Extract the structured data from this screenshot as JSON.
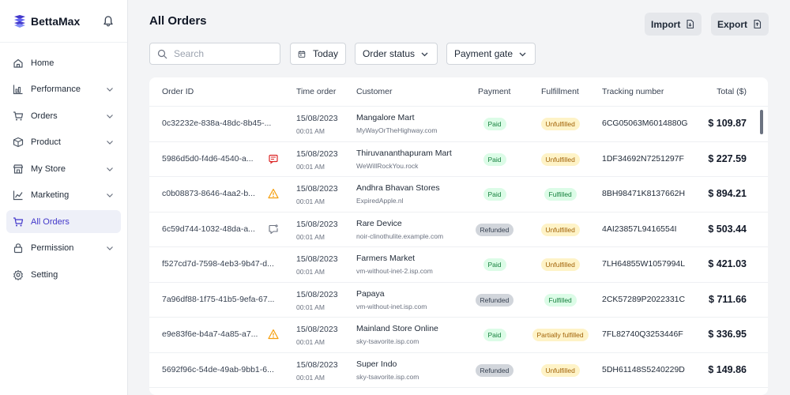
{
  "brand": {
    "name": "BettaMax",
    "logo_icon": "betta-logo-icon",
    "accent": "#4338ca"
  },
  "sidebar": {
    "items": [
      {
        "label": "Home",
        "icon": "home-icon",
        "chevron": false
      },
      {
        "label": "Performance",
        "icon": "chart-icon",
        "chevron": true
      },
      {
        "label": "Orders",
        "icon": "cart-icon",
        "chevron": true
      },
      {
        "label": "Product",
        "icon": "box-icon",
        "chevron": true
      },
      {
        "label": "My Store",
        "icon": "store-icon",
        "chevron": true
      },
      {
        "label": "Marketing",
        "icon": "marketing-chart-icon",
        "chevron": true
      },
      {
        "label": "All Orders",
        "icon": "cart-icon",
        "chevron": false,
        "active": true
      },
      {
        "label": "Permission",
        "icon": "lock-icon",
        "chevron": true
      },
      {
        "label": "Setting",
        "icon": "gear-icon",
        "chevron": false
      }
    ]
  },
  "header": {
    "title": "All Orders",
    "import_label": "Import",
    "export_label": "Export"
  },
  "filters": {
    "search_placeholder": "Search",
    "date_label": "Today",
    "status_label": "Order status",
    "gateway_label": "Payment gate"
  },
  "table": {
    "columns": [
      "Order ID",
      "Time order",
      "Customer",
      "Payment",
      "Fulfillment",
      "Tracking number",
      "Total ($)"
    ],
    "rows": [
      {
        "order_id": "0c32232e-838a-48dc-8b45-...",
        "icon": "",
        "date": "15/08/2023",
        "time": "00:01 AM",
        "customer": "Mangalore Mart",
        "domain": "MyWayOrTheHighway.com",
        "payment": "Paid",
        "fulfillment": "Unfulfilled",
        "tracking": "6CG05063M6014880G",
        "total": "$ 109.87"
      },
      {
        "order_id": "5986d5d0-f4d6-4540-a...",
        "icon": "note-icon",
        "date": "15/08/2023",
        "time": "00:01 AM",
        "customer": "Thiruvananthapuram Mart",
        "domain": "WeWillRockYou.rock",
        "payment": "Paid",
        "fulfillment": "Unfulfilled",
        "tracking": "1DF34692N7251297F",
        "total": "$ 227.59"
      },
      {
        "order_id": "c0b08873-8646-4aa2-b...",
        "icon": "warning-icon",
        "date": "15/08/2023",
        "time": "00:01 AM",
        "customer": "Andhra Bhavan Stores",
        "domain": "ExpiredApple.nl",
        "payment": "Paid",
        "fulfillment": "Fulfilled",
        "tracking": "8BH98471K8137662H",
        "total": "$ 894.21"
      },
      {
        "order_id": "6c59d744-1032-48da-a...",
        "icon": "comment-icon",
        "date": "15/08/2023",
        "time": "00:01 AM",
        "customer": "Rare Device",
        "domain": "noir-clinothulite.example.com",
        "payment": "Refunded",
        "fulfillment": "Unfulfilled",
        "tracking": "4AI23857L9416554I",
        "total": "$ 503.44"
      },
      {
        "order_id": "f527cd7d-7598-4eb3-9b47-d...",
        "icon": "",
        "date": "15/08/2023",
        "time": "00:01 AM",
        "customer": "Farmers Market",
        "domain": "vm-without-inet-2.isp.com",
        "payment": "Paid",
        "fulfillment": "Unfulfilled",
        "tracking": "7LH64855W1057994L",
        "total": "$ 421.03"
      },
      {
        "order_id": "7a96df88-1f75-41b5-9efa-67...",
        "icon": "",
        "date": "15/08/2023",
        "time": "00:01 AM",
        "customer": "Papaya",
        "domain": "vm-without-inet.isp.com",
        "payment": "Refunded",
        "fulfillment": "Fulfilled",
        "tracking": "2CK57289P2022331C",
        "total": "$ 711.66"
      },
      {
        "order_id": "e9e83f6e-b4a7-4a85-a7...",
        "icon": "warning-icon",
        "date": "15/08/2023",
        "time": "00:01 AM",
        "customer": "Mainland Store Online",
        "domain": "sky-tsavorite.isp.com",
        "payment": "Paid",
        "fulfillment": "Partially fulfilled",
        "tracking": "7FL82740Q3253446F",
        "total": "$ 336.95"
      },
      {
        "order_id": "5692f96c-54de-49ab-9bb1-6...",
        "icon": "",
        "date": "15/08/2023",
        "time": "00:01 AM",
        "customer": "Super Indo",
        "domain": "sky-tsavorite.isp.com",
        "payment": "Refunded",
        "fulfillment": "Unfulfilled",
        "tracking": "5DH61148S5240229D",
        "total": "$ 149.86"
      }
    ]
  },
  "colors": {
    "paid_bg": "#dcfce7",
    "paid_fg": "#15803d",
    "refunded_bg": "#d1d5db",
    "refunded_fg": "#374151",
    "unfulfilled_bg": "#fef3c7",
    "unfulfilled_fg": "#a16207",
    "fulfilled_bg": "#dcfce7",
    "fulfilled_fg": "#15803d",
    "partial_bg": "#fef3c7",
    "partial_fg": "#a16207",
    "note_icon": "#dc2626",
    "warning_icon": "#f59e0b",
    "comment_icon": "#6b7280"
  }
}
